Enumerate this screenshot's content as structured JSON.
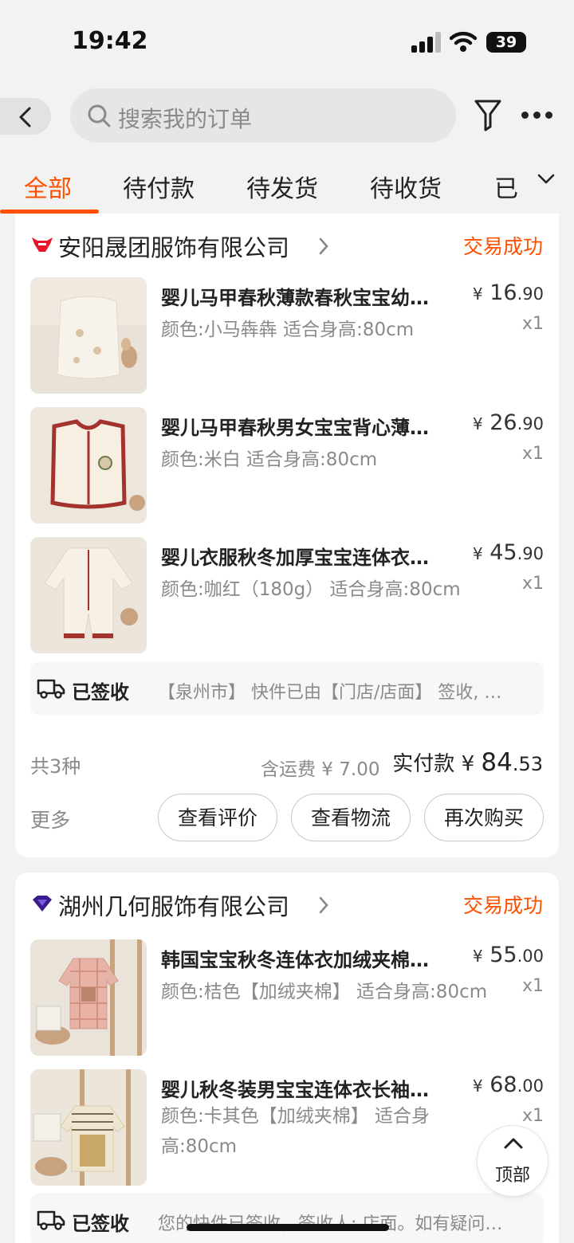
{
  "status_bar": {
    "time": "19:42",
    "battery": "39"
  },
  "header": {
    "search_placeholder": "搜索我的订单"
  },
  "tabs": [
    {
      "label": "全部",
      "active": true
    },
    {
      "label": "待付款"
    },
    {
      "label": "待发货"
    },
    {
      "label": "待收货"
    },
    {
      "label": "已"
    }
  ],
  "orders": [
    {
      "shop": "安阳晟团服饰有限公司",
      "status": "交易成功",
      "items": [
        {
          "title": "婴儿马甲春秋薄款春秋宝宝幼…",
          "spec": "颜色:小马犇犇 适合身高:80cm",
          "price_int": "16",
          "price_dec": ".90",
          "qty": "x1"
        },
        {
          "title": "婴儿马甲春秋男女宝宝背心薄…",
          "spec": "颜色:米白 适合身高:80cm",
          "price_int": "26",
          "price_dec": ".90",
          "qty": "x1"
        },
        {
          "title": "婴儿衣服秋冬加厚宝宝连体衣…",
          "spec": "颜色:咖红（180g） 适合身高:80cm",
          "price_int": "45",
          "price_dec": ".90",
          "qty": "x1"
        }
      ],
      "shipping": {
        "state": "已签收",
        "message": "【泉州市】 快件已由【门店/店面】 签收, …"
      },
      "summary": {
        "count": "共3种",
        "freight": "含运费 ¥ 7.00",
        "paid_label": "实付款",
        "paid_int": "84",
        "paid_dec": ".53"
      },
      "more": "更多",
      "buttons": [
        "查看评价",
        "查看物流",
        "再次购买"
      ]
    },
    {
      "shop": "湖州几何服饰有限公司",
      "status": "交易成功",
      "items": [
        {
          "title": "韩国宝宝秋冬连体衣加绒夹棉…",
          "spec": "颜色:桔色【加绒夹棉】 适合身高:80cm",
          "price_int": "55",
          "price_dec": ".00",
          "qty": "x1"
        },
        {
          "title": "婴儿秋冬装男宝宝连体衣长袖…",
          "spec": "颜色:卡其色【加绒夹棉】 适合身高:80cm",
          "price_int": "68",
          "price_dec": ".00",
          "qty": "x1"
        }
      ],
      "shipping": {
        "state": "已签收",
        "message": "您的快件已签收，签收人: 店面。如有疑问…"
      }
    }
  ],
  "currency": "¥",
  "back_to_top": "顶部",
  "colors": {
    "accent": "#ff5000",
    "background": "#f2f2f2"
  }
}
